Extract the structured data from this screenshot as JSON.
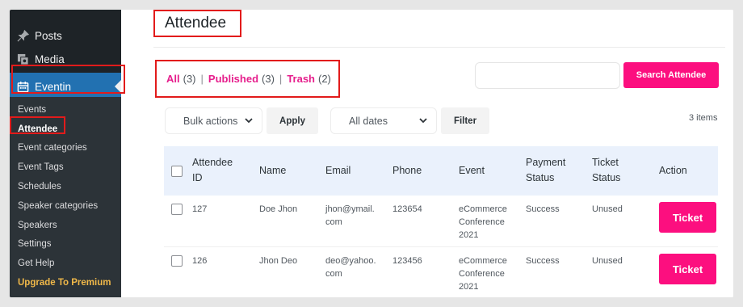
{
  "sidebar": {
    "top_items": [
      {
        "label": "Posts",
        "icon": "pin-icon"
      },
      {
        "label": "Media",
        "icon": "media-icon"
      },
      {
        "label": "Eventin",
        "icon": "calendar-icon"
      }
    ],
    "sub_items": [
      "Events",
      "Attendee",
      "Event categories",
      "Event Tags",
      "Schedules",
      "Speaker categories",
      "Speakers",
      "Settings",
      "Get Help",
      "Upgrade To Premium"
    ]
  },
  "header": {
    "title": "Attendee"
  },
  "filters": {
    "all_label": "All",
    "all_count": "(3)",
    "published_label": "Published",
    "published_count": "(3)",
    "trash_label": "Trash",
    "trash_count": "(2)",
    "separator": "|"
  },
  "search": {
    "placeholder": "",
    "button_label": "Search Attendee"
  },
  "toolbar": {
    "bulk_actions": "Bulk actions",
    "apply_label": "Apply",
    "dates": "All dates",
    "filter_label": "Filter",
    "items_count": "3 items"
  },
  "table": {
    "headers": {
      "id_line1": "Attendee",
      "id_line2": "ID",
      "name": "Name",
      "email": "Email",
      "phone": "Phone",
      "event": "Event",
      "payment_line1": "Payment",
      "payment_line2": "Status",
      "ticket_line1": "Ticket",
      "ticket_line2": "Status",
      "action": "Action"
    },
    "rows": [
      {
        "id": "127",
        "name": "Doe Jhon",
        "email_l1": "jhon@ymail.",
        "email_l2": "com",
        "phone": "123654",
        "event_l1": "eCommerce",
        "event_l2": "Conference",
        "event_l3": "2021",
        "payment": "Success",
        "ticket_status": "Unused",
        "action": "Ticket"
      },
      {
        "id": "126",
        "name": "Jhon Deo",
        "email_l1": "deo@yahoo.",
        "email_l2": "com",
        "phone": "123456",
        "event_l1": "eCommerce",
        "event_l2": "Conference",
        "event_l3": "2021",
        "payment": "Success",
        "ticket_status": "Unused",
        "action": "Ticket"
      }
    ]
  },
  "colors": {
    "accent": "#fc0f7f",
    "link": "#e61e8c",
    "highlight": "#e21b1b",
    "admin_blue": "#2271b1",
    "sidebar": "#1e2327"
  }
}
